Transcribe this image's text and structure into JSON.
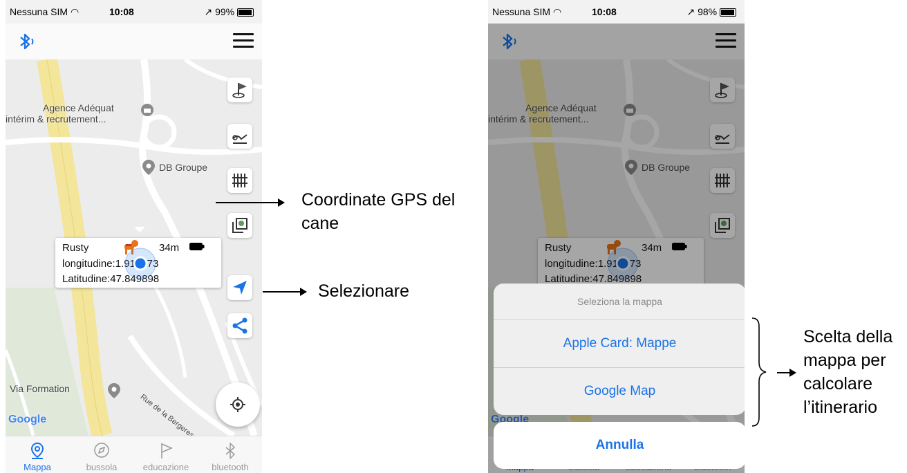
{
  "status_bar": {
    "carrier": "Nessuna SIM",
    "time": "10:08",
    "battery_left": "99%",
    "battery_right": "98%"
  },
  "map": {
    "poi_agence_line1": "Agence Adéquat",
    "poi_agence_line2": "intérim & recrutement...",
    "poi_db": "DB Groupe",
    "poi_via": "Via Formation",
    "road_bergeresse": "Rue de la Bergeresse",
    "google_logo": "Google"
  },
  "dog_card": {
    "name": "Rusty",
    "distance": "34m",
    "longitude": "longitudine:1.913073",
    "latitude": "Latitudine:47.849898"
  },
  "tabs": [
    {
      "label": "Mappa",
      "icon": "map-pin-icon"
    },
    {
      "label": "bussola",
      "icon": "compass-icon"
    },
    {
      "label": "educazione",
      "icon": "flag-icon"
    },
    {
      "label": "bluetooth",
      "icon": "bluetooth-icon"
    }
  ],
  "action_sheet": {
    "title": "Seleziona la mappa",
    "option_apple": "Apple Card: Mappe",
    "option_google": "Google Map",
    "cancel": "Annulla"
  },
  "annotations": {
    "gps_line1": "Coordinate GPS del",
    "gps_line2": "cane",
    "select": "Selezionare",
    "choice_line1": "Scelta della",
    "choice_line2": "mappa per",
    "choice_line3": "calcolare",
    "choice_line4": "l’itinerario"
  },
  "colors": {
    "accent": "#1a73e8",
    "road_yellow": "#f3e59a",
    "map_bg": "#ececec"
  }
}
